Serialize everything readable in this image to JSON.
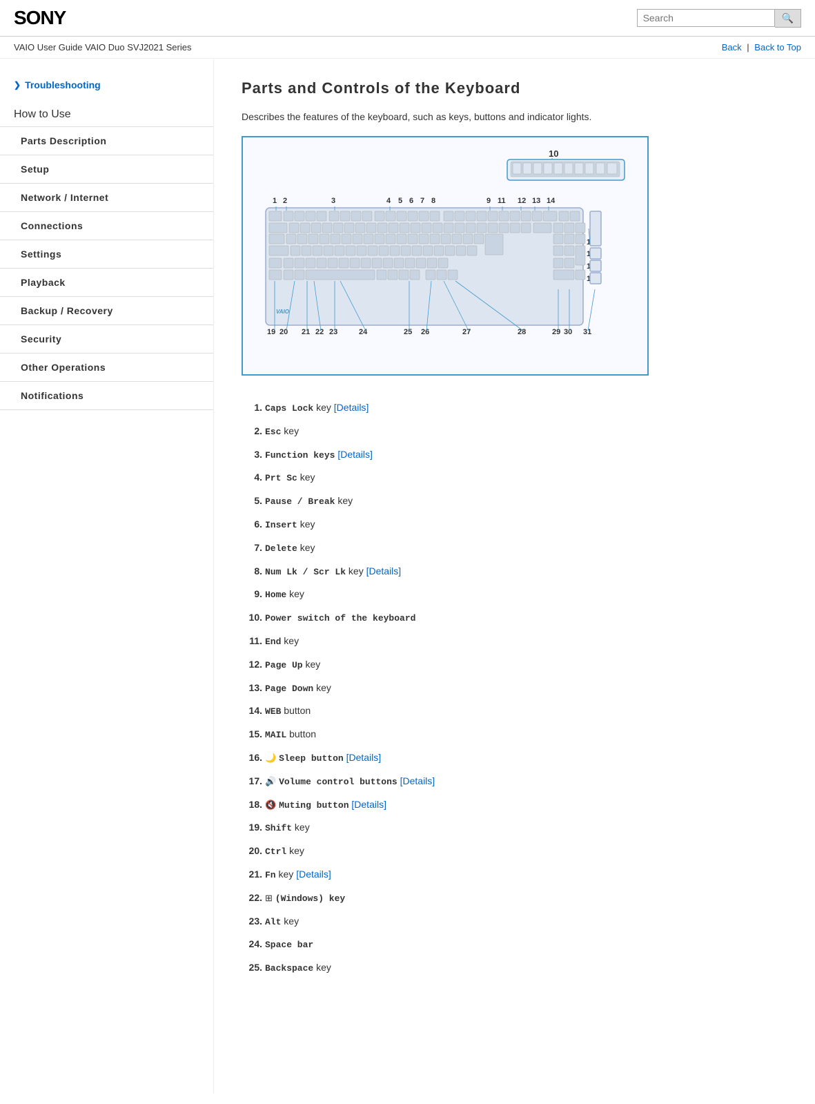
{
  "header": {
    "logo": "SONY",
    "search_placeholder": "Search",
    "search_button_label": "🔍"
  },
  "breadcrumb": {
    "guide_title": "VAIO User Guide VAIO Duo SVJ2021 Series",
    "back_label": "Back",
    "back_to_top_label": "Back to Top",
    "separator": "|"
  },
  "sidebar": {
    "troubleshooting_label": "Troubleshooting",
    "how_to_use_label": "How to Use",
    "items": [
      {
        "id": "parts-description",
        "label": "Parts Description"
      },
      {
        "id": "setup",
        "label": "Setup"
      },
      {
        "id": "network-internet",
        "label": "Network / Internet"
      },
      {
        "id": "connections",
        "label": "Connections"
      },
      {
        "id": "settings",
        "label": "Settings"
      },
      {
        "id": "playback",
        "label": "Playback"
      },
      {
        "id": "backup-recovery",
        "label": "Backup / Recovery"
      },
      {
        "id": "security",
        "label": "Security"
      },
      {
        "id": "other-operations",
        "label": "Other Operations"
      },
      {
        "id": "notifications",
        "label": "Notifications"
      }
    ]
  },
  "main": {
    "title": "Parts and Controls of the Keyboard",
    "description": "Describes the features of the keyboard, such as keys, buttons and indicator lights.",
    "keys": [
      {
        "num": "1.",
        "label": "Caps Lock",
        "suffix": "key",
        "link_label": "[Details]",
        "has_link": true
      },
      {
        "num": "2.",
        "label": "Esc",
        "suffix": "key",
        "has_link": false
      },
      {
        "num": "3.",
        "label": "Function keys",
        "suffix": "",
        "link_label": "[Details]",
        "has_link": true
      },
      {
        "num": "4.",
        "label": "Prt Sc",
        "suffix": "key",
        "has_link": false
      },
      {
        "num": "5.",
        "label": "Pause / Break",
        "suffix": "key",
        "has_link": false
      },
      {
        "num": "6.",
        "label": "Insert",
        "suffix": "key",
        "has_link": false
      },
      {
        "num": "7.",
        "label": "Delete",
        "suffix": "key",
        "has_link": false
      },
      {
        "num": "8.",
        "label": "Num Lk / Scr Lk",
        "suffix": "key",
        "link_label": "[Details]",
        "has_link": true
      },
      {
        "num": "9.",
        "label": "Home",
        "suffix": "key",
        "has_link": false
      },
      {
        "num": "10.",
        "label": "Power switch of the keyboard",
        "suffix": "",
        "has_link": false
      },
      {
        "num": "11.",
        "label": "End",
        "suffix": "key",
        "has_link": false
      },
      {
        "num": "12.",
        "label": "Page Up",
        "suffix": "key",
        "has_link": false
      },
      {
        "num": "13.",
        "label": "Page Down",
        "suffix": "key",
        "has_link": false
      },
      {
        "num": "14.",
        "label": "WEB",
        "suffix": "button",
        "has_link": false
      },
      {
        "num": "15.",
        "label": "MAIL",
        "suffix": "button",
        "has_link": false
      },
      {
        "num": "16.",
        "label": "Sleep button",
        "suffix": "",
        "icon": "🌙",
        "link_label": "[Details]",
        "has_link": true
      },
      {
        "num": "17.",
        "label": "Volume control buttons",
        "suffix": "",
        "icon": "🔊",
        "link_label": "[Details]",
        "has_link": true
      },
      {
        "num": "18.",
        "label": "Muting button",
        "suffix": "",
        "icon": "🔇",
        "link_label": "[Details]",
        "has_link": true
      },
      {
        "num": "19.",
        "label": "Shift",
        "suffix": "key",
        "has_link": false
      },
      {
        "num": "20.",
        "label": "Ctrl",
        "suffix": "key",
        "has_link": false
      },
      {
        "num": "21.",
        "label": "Fn",
        "suffix": "key",
        "link_label": "[Details]",
        "has_link": true
      },
      {
        "num": "22.",
        "label": "(Windows) key",
        "suffix": "",
        "icon": "⊞",
        "has_link": false
      },
      {
        "num": "23.",
        "label": "Alt",
        "suffix": "key",
        "has_link": false
      },
      {
        "num": "24.",
        "label": "Space bar",
        "suffix": "",
        "has_link": false
      },
      {
        "num": "25.",
        "label": "Backspace",
        "suffix": "key",
        "has_link": false
      }
    ]
  }
}
